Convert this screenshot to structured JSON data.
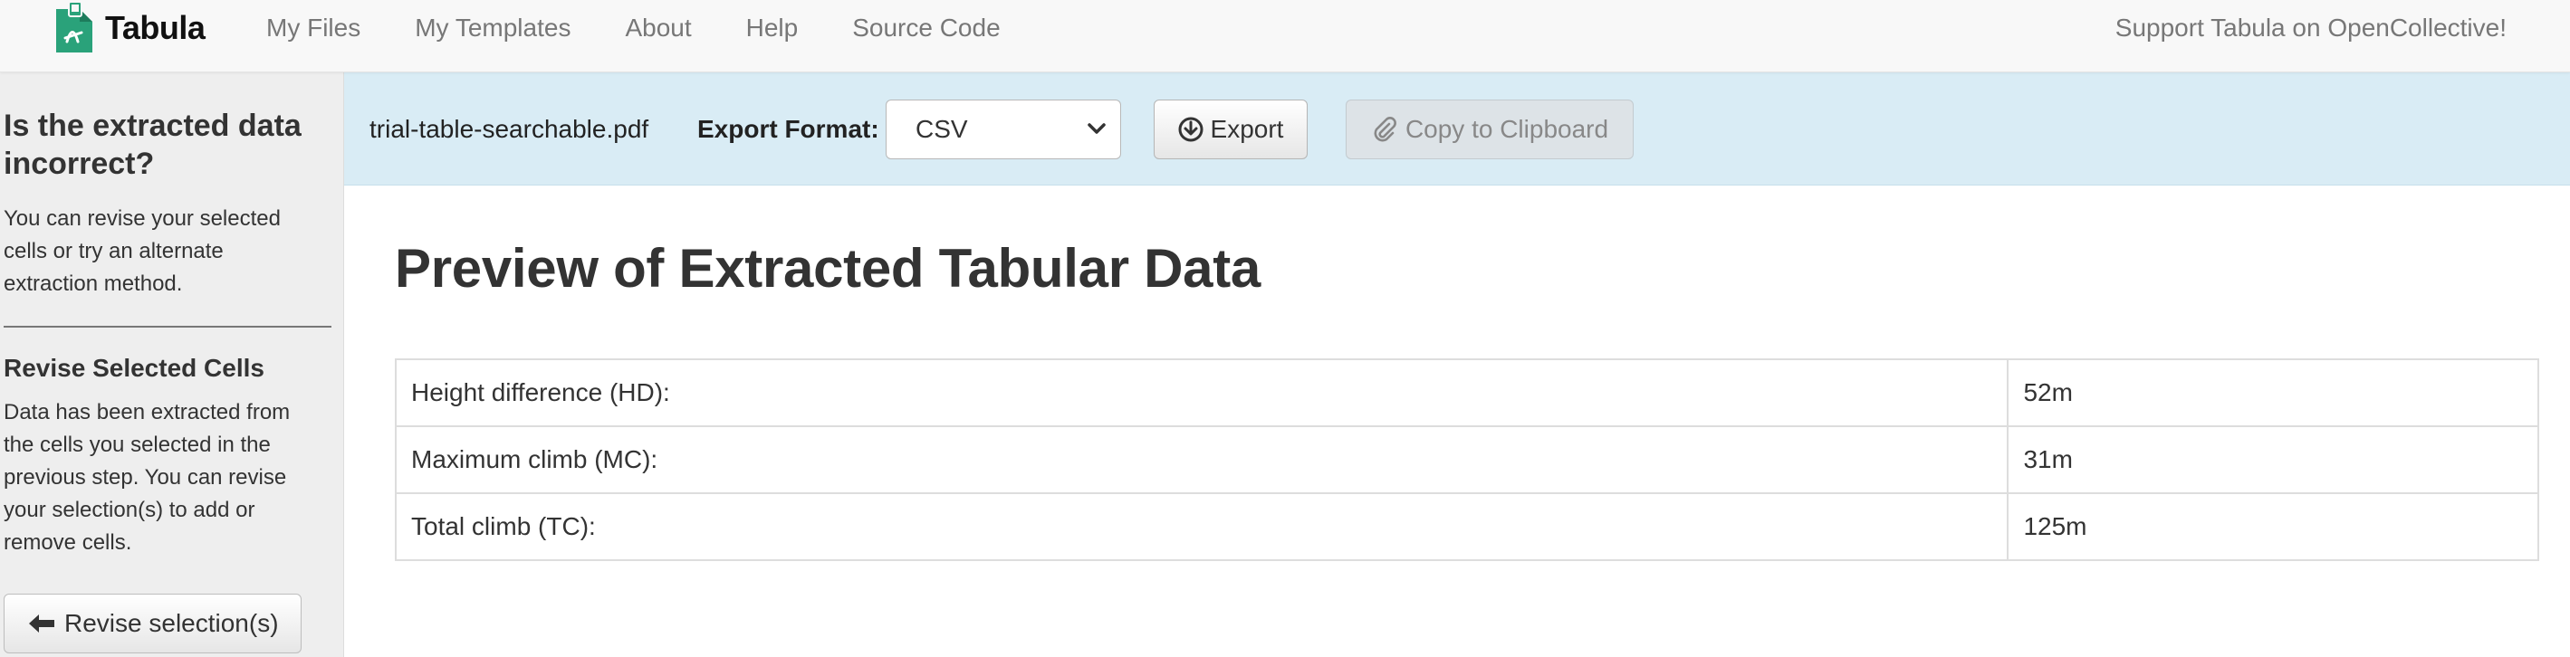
{
  "navbar": {
    "brand": "Tabula",
    "links": [
      "My Files",
      "My Templates",
      "About",
      "Help",
      "Source Code"
    ],
    "support": "Support Tabula on OpenCollective!"
  },
  "sidebar": {
    "heading": "Is the extracted data incorrect?",
    "intro": "You can revise your selected cells or try an alternate extraction method.",
    "revise_heading": "Revise Selected Cells",
    "revise_text": "Data has been extracted from the cells you selected in the previous step. You can revise your selection(s) to add or remove cells.",
    "revise_button": "Revise selection(s)"
  },
  "toolbar": {
    "filename": "trial-table-searchable.pdf",
    "format_label": "Export Format:",
    "format_value": "CSV",
    "export_button": "Export",
    "copy_button": "Copy to Clipboard"
  },
  "main": {
    "title": "Preview of Extracted Tabular Data",
    "rows": [
      [
        "Height difference (HD):",
        "52m"
      ],
      [
        "Maximum climb (MC):",
        "31m"
      ],
      [
        "Total climb (TC):",
        "125m"
      ]
    ]
  },
  "icons": {
    "brand": "tabula-logo-icon",
    "select": "chevron-down-icon",
    "export": "download-circle-icon",
    "copy": "paperclip-icon",
    "revise": "arrow-left-icon"
  },
  "colors": {
    "brand_green": "#2aa27a",
    "toolbar_bg": "#d9ecf5",
    "sidebar_bg": "#eeeeee"
  }
}
